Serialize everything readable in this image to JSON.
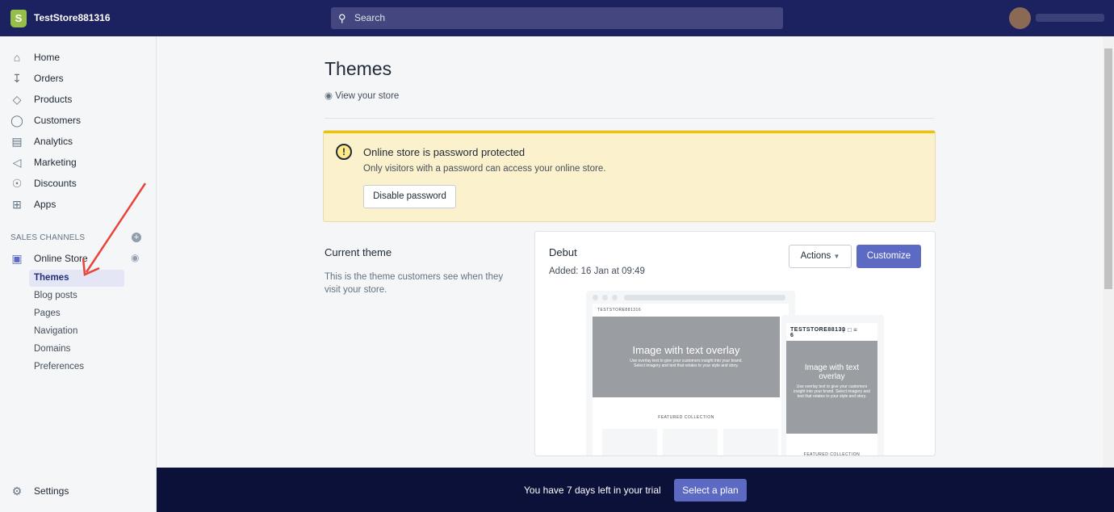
{
  "topbar": {
    "store_name": "TestStore881316",
    "search_placeholder": "Search",
    "logo_letter": "S",
    "brand_color": "#1c2260"
  },
  "sidebar": {
    "items": [
      {
        "label": "Home",
        "icon": "home-icon"
      },
      {
        "label": "Orders",
        "icon": "orders-icon"
      },
      {
        "label": "Products",
        "icon": "tag-icon"
      },
      {
        "label": "Customers",
        "icon": "person-icon"
      },
      {
        "label": "Analytics",
        "icon": "bar-chart-icon"
      },
      {
        "label": "Marketing",
        "icon": "megaphone-icon"
      },
      {
        "label": "Discounts",
        "icon": "discount-icon"
      },
      {
        "label": "Apps",
        "icon": "apps-icon"
      }
    ],
    "sales_channels": "SALES CHANNELS",
    "online_store": "Online Store",
    "sub_items": [
      {
        "label": "Themes",
        "active": true
      },
      {
        "label": "Blog posts"
      },
      {
        "label": "Pages"
      },
      {
        "label": "Navigation"
      },
      {
        "label": "Domains"
      },
      {
        "label": "Preferences"
      }
    ],
    "settings": "Settings"
  },
  "main": {
    "title": "Themes",
    "view_store": "View your store",
    "banner": {
      "title": "Online store is password protected",
      "description": "Only visitors with a password can access your online store.",
      "button": "Disable password"
    },
    "current_theme": {
      "heading": "Current theme",
      "description": "This is the theme customers see when they visit your store."
    },
    "theme_card": {
      "name": "Debut",
      "added": "Added: 16 Jan at 09:49",
      "actions": "Actions",
      "customize": "Customize",
      "preview": {
        "store": "TESTSTORE881316",
        "mobile_store": "TESTSTORE88131 6",
        "hero_title": "Image with text overlay",
        "hero_text": "Use overlay text to give your customers insight into your brand. Select imagery and text that relates to your style and story.",
        "featured": "FEATURED COLLECTION"
      }
    }
  },
  "trial": {
    "message": "You have 7 days left in your trial",
    "button": "Select a plan"
  }
}
